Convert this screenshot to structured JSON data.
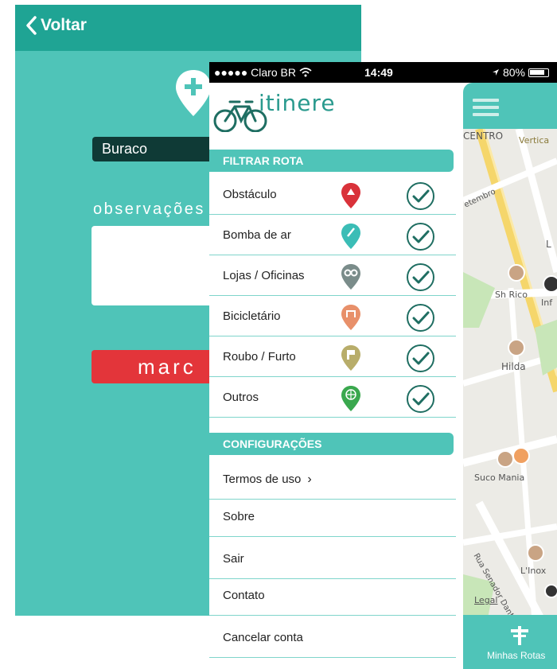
{
  "back_screen": {
    "back_label": "Voltar",
    "type_value": "Buraco",
    "observations_label": "observações",
    "mark_button_label": "marc"
  },
  "status_bar": {
    "carrier": "●●●●● Claro BR",
    "time": "14:49",
    "battery": "80%"
  },
  "app": {
    "logo_text": "itinere"
  },
  "filter_section": {
    "title": "FILTRAR ROTA",
    "items": [
      {
        "label": "Obstáculo",
        "icon": "obstacle-pin-icon",
        "color": "#d9323a",
        "checked": true
      },
      {
        "label": "Bomba de ar",
        "icon": "air-pump-pin-icon",
        "color": "#3bbdb6",
        "checked": true
      },
      {
        "label": "Lojas / Oficinas",
        "icon": "shop-pin-icon",
        "color": "#7a8c8a",
        "checked": true
      },
      {
        "label": "Bicicletário",
        "icon": "bike-rack-pin-icon",
        "color": "#e8906a",
        "checked": true
      },
      {
        "label": "Roubo / Furto",
        "icon": "theft-pin-icon",
        "color": "#b8ad6a",
        "checked": true
      },
      {
        "label": "Outros",
        "icon": "other-pin-icon",
        "color": "#3aa84e",
        "checked": true
      }
    ]
  },
  "config_section": {
    "title": "CONFIGURAÇÕES",
    "items": [
      {
        "label": "Termos de uso",
        "chevron": "›"
      },
      {
        "label": "Sobre"
      },
      {
        "label": "Sair"
      },
      {
        "label": "Contato"
      },
      {
        "label": "Cancelar conta"
      }
    ]
  },
  "map": {
    "labels": {
      "centro": "CENTRO",
      "vertical": "Vertica",
      "setembro": "etembro",
      "sh_rico": "Sh Rico",
      "inf": "Inf",
      "hilda": "Hilda",
      "suco_mania": "Suco Mania",
      "rua_senador": "Rua Senador Dantas",
      "linox": "L'Inox",
      "legal": "Legal",
      "l": "L"
    },
    "bottom_tab": "Minhas Rotas"
  },
  "colors": {
    "teal": "#4fc4b8",
    "teal_dark": "#1fa494",
    "red": "#e3353a",
    "check_green": "#1f6e62"
  }
}
